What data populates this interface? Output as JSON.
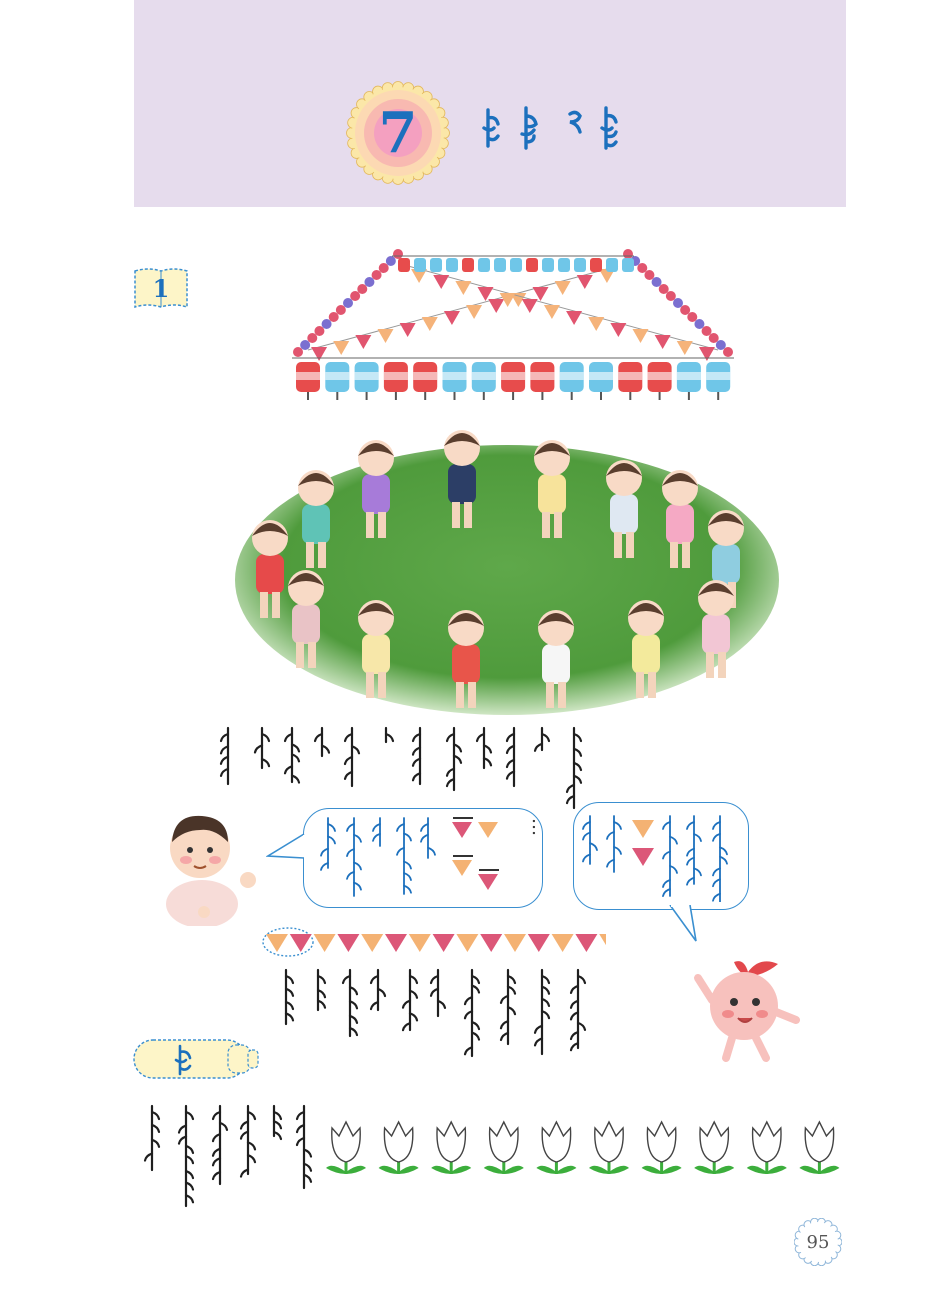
{
  "header": {
    "unit_number": "7",
    "unit_title_icon": "mongolian-script-title",
    "band_color": "#e6dced"
  },
  "section_1": {
    "number": "1"
  },
  "scene": {
    "icon": "children-dancing-in-circle-illustration",
    "bunting_colors": [
      "#e1556f",
      "#f5b37a"
    ],
    "lantern_colors": [
      "#e74c4c",
      "#6fc6e8"
    ]
  },
  "sequence_row": {
    "pattern": [
      "orange",
      "red",
      "orange",
      "red",
      "orange",
      "red",
      "orange",
      "red",
      "orange",
      "red",
      "orange",
      "red",
      "orange",
      "red",
      "orange"
    ],
    "orange": "#f4b273",
    "red": "#dc5778"
  },
  "speech_left": {
    "ellipsis": "…",
    "triangles": [
      "red",
      "orange",
      "orange",
      "red"
    ]
  },
  "speech_right": {
    "triangles": [
      "orange",
      "red"
    ]
  },
  "practice": {
    "label_icon": "mongolian-practice-label",
    "flower_count": 10,
    "flower_icon": "tulip-icon"
  },
  "page": {
    "number": "95"
  }
}
